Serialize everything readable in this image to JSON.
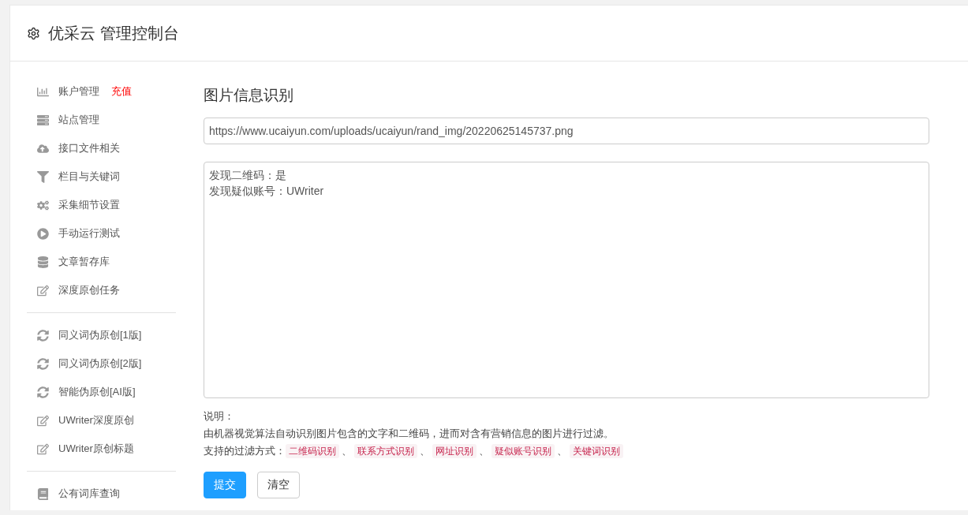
{
  "header": {
    "title": "优采云 管理控制台"
  },
  "sidebar": {
    "groups": [
      {
        "items": [
          {
            "kind": "chart",
            "label": "账户管理",
            "badge": "充值"
          },
          {
            "kind": "server",
            "label": "站点管理"
          },
          {
            "kind": "upload",
            "label": "接口文件相关"
          },
          {
            "kind": "filter",
            "label": "栏目与关键词"
          },
          {
            "kind": "cogs",
            "label": "采集细节设置"
          },
          {
            "kind": "play",
            "label": "手动运行测试"
          },
          {
            "kind": "database",
            "label": "文章暂存库"
          },
          {
            "kind": "edit",
            "label": "深度原创任务"
          }
        ]
      },
      {
        "items": [
          {
            "kind": "sync",
            "label": "同义词伪原创[1版]"
          },
          {
            "kind": "sync",
            "label": "同义词伪原创[2版]"
          },
          {
            "kind": "sync",
            "label": "智能伪原创[AI版]"
          },
          {
            "kind": "edit",
            "label": "UWriter深度原创"
          },
          {
            "kind": "edit",
            "label": "UWriter原创标题"
          }
        ]
      },
      {
        "items": [
          {
            "kind": "book",
            "label": "公有词库查询"
          }
        ]
      }
    ]
  },
  "main": {
    "title": "图片信息识别",
    "url_field": {
      "value": "https://www.ucaiyun.com/uploads/ucaiyun/rand_img/20220625145737.png"
    },
    "result_box": {
      "lines": [
        "发现二维码：是",
        "发现疑似账号：UWriter"
      ]
    },
    "note": {
      "heading": "说明：",
      "description": "由机器视觉算法自动识别图片包含的文字和二维码，进而对含有营销信息的图片进行过滤。",
      "methods_label": "支持的过滤方式：",
      "separator": "、",
      "methods": [
        "二维码识别",
        "联系方式识别",
        "网址识别",
        "疑似账号识别",
        "关键词识别"
      ]
    },
    "buttons": [
      {
        "kind": "primary",
        "label": "提交"
      },
      {
        "kind": "default",
        "label": "清空"
      }
    ]
  }
}
